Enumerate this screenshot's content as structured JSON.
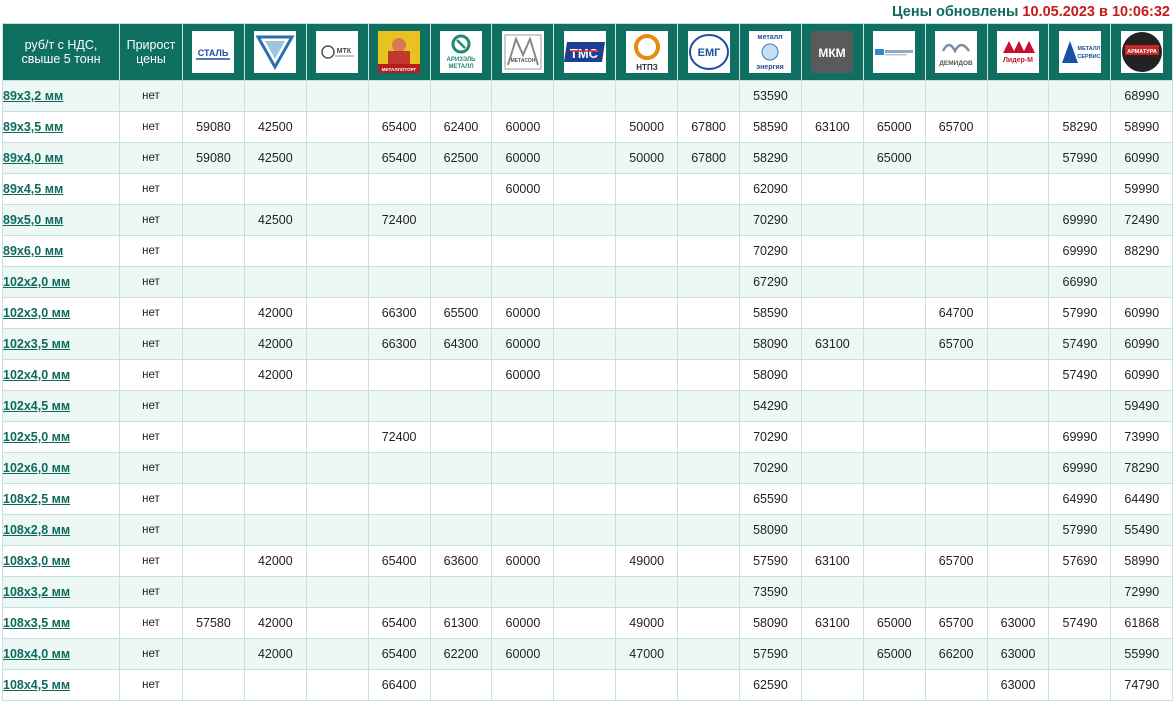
{
  "header": {
    "updated_label": "Цены обновлены",
    "updated_datetime": "10.05.2023 в 10:06:32"
  },
  "columns": {
    "size_header": "руб/т с НДС, свыше 5 тонн",
    "growth_header": "Прирост цены"
  },
  "suppliers": [
    {
      "name": "Сталь",
      "logo_text": "СТАЛЬ",
      "icon": "stal-logo-icon"
    },
    {
      "name": "Треугольник",
      "logo_text": "",
      "icon": "triangle-logo-icon"
    },
    {
      "name": "МТК",
      "logo_text": "МТК",
      "icon": "mtk-logo-icon"
    },
    {
      "name": "Металлоторг",
      "logo_text": "МЕТАЛЛОТОРГ",
      "icon": "metallotorg-logo-icon"
    },
    {
      "name": "Аризэль Металл",
      "logo_text": "АРИЗЭЛЬ МЕТАЛЛ",
      "icon": "arizel-logo-icon"
    },
    {
      "name": "Метасон",
      "logo_text": "МЕТАСОН",
      "icon": "metason-logo-icon"
    },
    {
      "name": "ТМС",
      "logo_text": "ТМС",
      "icon": "tms-logo-icon"
    },
    {
      "name": "НТПЗ",
      "logo_text": "НТПЗ",
      "icon": "ntpz-logo-icon"
    },
    {
      "name": "ЕМГ",
      "logo_text": "ЕМГ",
      "icon": "emg-logo-icon"
    },
    {
      "name": "Металл энергия",
      "logo_text_top": "металл",
      "logo_text_bottom": "энергия",
      "icon": "metall-energiya-logo-icon"
    },
    {
      "name": "МКМ",
      "logo_text": "МКМ",
      "icon": "mkm-logo-icon"
    },
    {
      "name": "Металлоснабжающая компания",
      "logo_text": "",
      "icon": "blue-stripe-logo-icon"
    },
    {
      "name": "Демидов",
      "logo_text": "ДЕМИДОВ",
      "icon": "demidov-logo-icon"
    },
    {
      "name": "Лидер-М",
      "logo_text": "Лидер-М",
      "icon": "lider-m-logo-icon"
    },
    {
      "name": "Металл Сервис",
      "logo_text": "МЕТАЛЛ СЕРВИС",
      "icon": "metall-servis-logo-icon"
    },
    {
      "name": "Арматура",
      "logo_text": "АРМАТУРА",
      "icon": "armatura-logo-icon"
    }
  ],
  "rows": [
    {
      "size": "89х3,2 мм",
      "growth": "нет",
      "prices": [
        "",
        "",
        "",
        "",
        "",
        "",
        "",
        "",
        "",
        "53590",
        "",
        "",
        "",
        "",
        "",
        "68990"
      ]
    },
    {
      "size": "89х3,5 мм",
      "growth": "нет",
      "prices": [
        "59080",
        "42500",
        "",
        "65400",
        "62400",
        "60000",
        "",
        "50000",
        "67800",
        "58590",
        "63100",
        "65000",
        "65700",
        "",
        "58290",
        "58990"
      ]
    },
    {
      "size": "89х4,0 мм",
      "growth": "нет",
      "prices": [
        "59080",
        "42500",
        "",
        "65400",
        "62500",
        "60000",
        "",
        "50000",
        "67800",
        "58290",
        "",
        "65000",
        "",
        "",
        "57990",
        "60990"
      ]
    },
    {
      "size": "89х4,5 мм",
      "growth": "нет",
      "prices": [
        "",
        "",
        "",
        "",
        "",
        "60000",
        "",
        "",
        "",
        "62090",
        "",
        "",
        "",
        "",
        "",
        "59990"
      ]
    },
    {
      "size": "89х5,0 мм",
      "growth": "нет",
      "prices": [
        "",
        "42500",
        "",
        "72400",
        "",
        "",
        "",
        "",
        "",
        "70290",
        "",
        "",
        "",
        "",
        "69990",
        "72490"
      ]
    },
    {
      "size": "89х6,0 мм",
      "growth": "нет",
      "prices": [
        "",
        "",
        "",
        "",
        "",
        "",
        "",
        "",
        "",
        "70290",
        "",
        "",
        "",
        "",
        "69990",
        "88290"
      ]
    },
    {
      "size": "102х2,0 мм",
      "growth": "нет",
      "prices": [
        "",
        "",
        "",
        "",
        "",
        "",
        "",
        "",
        "",
        "67290",
        "",
        "",
        "",
        "",
        "66990",
        ""
      ]
    },
    {
      "size": "102х3,0 мм",
      "growth": "нет",
      "prices": [
        "",
        "42000",
        "",
        "66300",
        "65500",
        "60000",
        "",
        "",
        "",
        "58590",
        "",
        "",
        "64700",
        "",
        "57990",
        "60990"
      ]
    },
    {
      "size": "102х3,5 мм",
      "growth": "нет",
      "prices": [
        "",
        "42000",
        "",
        "66300",
        "64300",
        "60000",
        "",
        "",
        "",
        "58090",
        "63100",
        "",
        "65700",
        "",
        "57490",
        "60990"
      ]
    },
    {
      "size": "102х4,0 мм",
      "growth": "нет",
      "prices": [
        "",
        "42000",
        "",
        "",
        "",
        "60000",
        "",
        "",
        "",
        "58090",
        "",
        "",
        "",
        "",
        "57490",
        "60990"
      ]
    },
    {
      "size": "102х4,5 мм",
      "growth": "нет",
      "prices": [
        "",
        "",
        "",
        "",
        "",
        "",
        "",
        "",
        "",
        "54290",
        "",
        "",
        "",
        "",
        "",
        "59490"
      ]
    },
    {
      "size": "102х5,0 мм",
      "growth": "нет",
      "prices": [
        "",
        "",
        "",
        "72400",
        "",
        "",
        "",
        "",
        "",
        "70290",
        "",
        "",
        "",
        "",
        "69990",
        "73990"
      ]
    },
    {
      "size": "102х6,0 мм",
      "growth": "нет",
      "prices": [
        "",
        "",
        "",
        "",
        "",
        "",
        "",
        "",
        "",
        "70290",
        "",
        "",
        "",
        "",
        "69990",
        "78290"
      ]
    },
    {
      "size": "108х2,5 мм",
      "growth": "нет",
      "prices": [
        "",
        "",
        "",
        "",
        "",
        "",
        "",
        "",
        "",
        "65590",
        "",
        "",
        "",
        "",
        "64990",
        "64490"
      ]
    },
    {
      "size": "108х2,8 мм",
      "growth": "нет",
      "prices": [
        "",
        "",
        "",
        "",
        "",
        "",
        "",
        "",
        "",
        "58090",
        "",
        "",
        "",
        "",
        "57990",
        "55490"
      ]
    },
    {
      "size": "108х3,0 мм",
      "growth": "нет",
      "prices": [
        "",
        "42000",
        "",
        "65400",
        "63600",
        "60000",
        "",
        "49000",
        "",
        "57590",
        "63100",
        "",
        "65700",
        "",
        "57690",
        "58990"
      ]
    },
    {
      "size": "108х3,2 мм",
      "growth": "нет",
      "prices": [
        "",
        "",
        "",
        "",
        "",
        "",
        "",
        "",
        "",
        "73590",
        "",
        "",
        "",
        "",
        "",
        "72990"
      ]
    },
    {
      "size": "108х3,5 мм",
      "growth": "нет",
      "prices": [
        "57580",
        "42000",
        "",
        "65400",
        "61300",
        "60000",
        "",
        "49000",
        "",
        "58090",
        "63100",
        "65000",
        "65700",
        "63000",
        "57490",
        "61868"
      ]
    },
    {
      "size": "108х4,0 мм",
      "growth": "нет",
      "prices": [
        "",
        "42000",
        "",
        "65400",
        "62200",
        "60000",
        "",
        "47000",
        "",
        "57590",
        "",
        "65000",
        "66200",
        "63000",
        "",
        "55990"
      ]
    },
    {
      "size": "108х4,5 мм",
      "growth": "нет",
      "prices": [
        "",
        "",
        "",
        "66400",
        "",
        "",
        "",
        "",
        "",
        "62590",
        "",
        "",
        "",
        "63000",
        "",
        "74790"
      ]
    }
  ],
  "colors": {
    "header_bg": "#0f6f61",
    "accent_text": "#0e6b5c",
    "date_red": "#c61a1a",
    "row_alt": "#edf7f4",
    "border": "#c7e1dc"
  }
}
